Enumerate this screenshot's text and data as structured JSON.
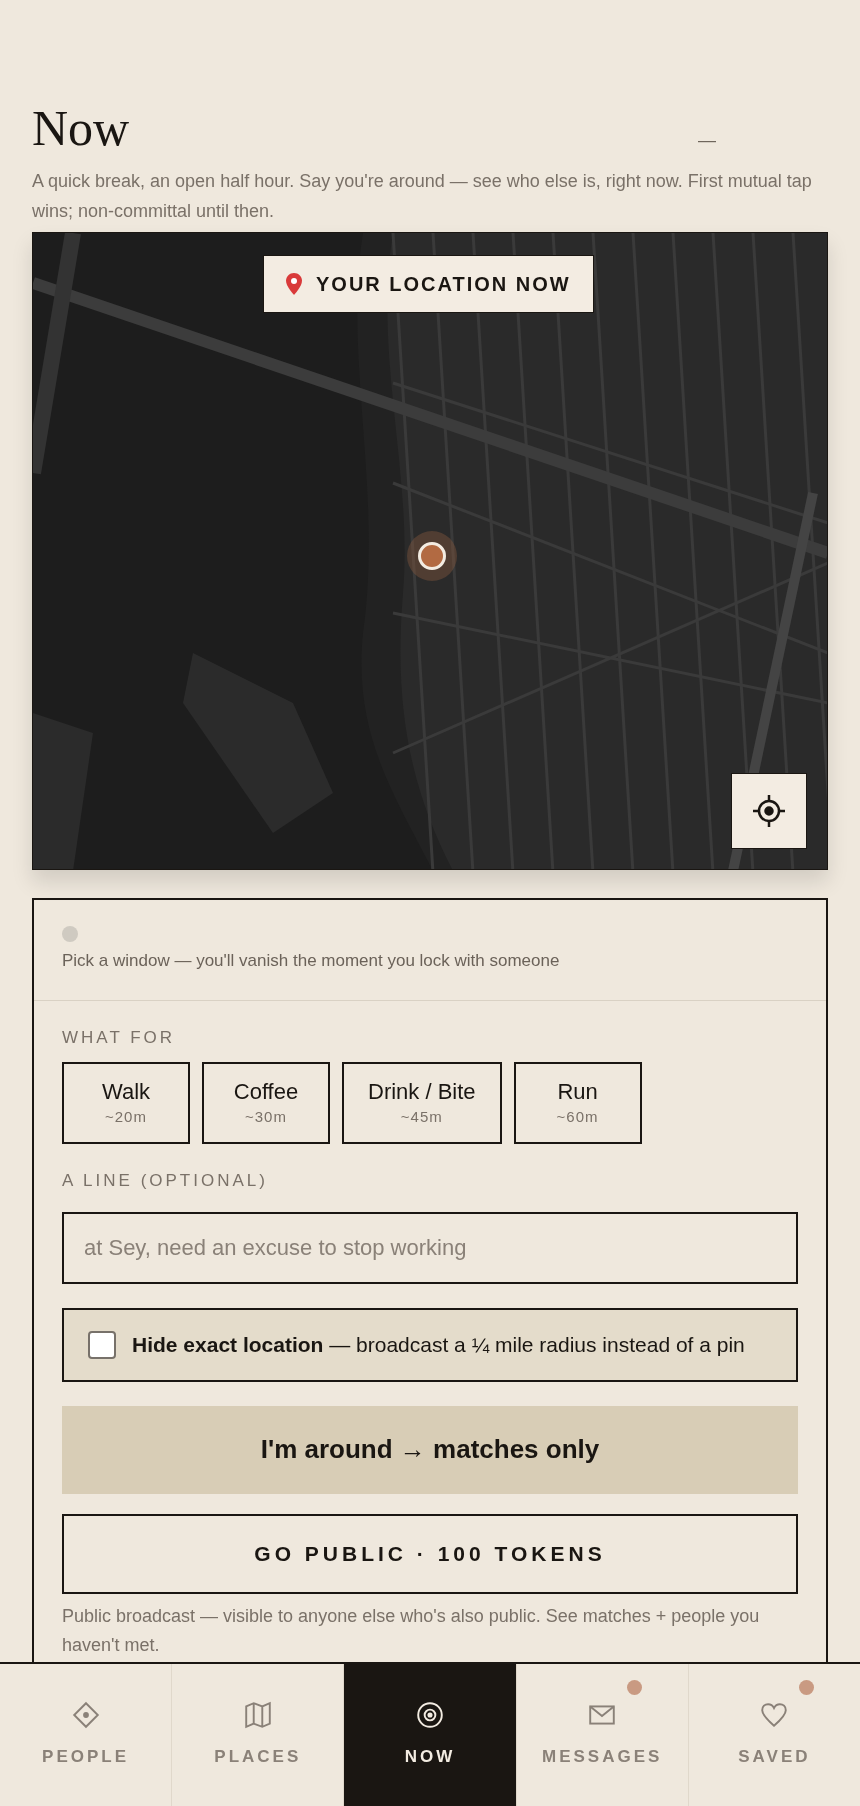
{
  "header": {
    "title": "Now",
    "mark": "—",
    "intro": "A quick break, an open half hour. Say you're around — see who else is, right now. First mutual tap wins; non-committal until then."
  },
  "map": {
    "kind": "picture",
    "badge": "YOUR LOCATION NOW"
  },
  "panel": {
    "status_hint": "Pick a window — you'll vanish the moment you lock with someone",
    "what_for_label": "WHAT FOR",
    "options": [
      {
        "label": "Walk",
        "duration": "~20m",
        "selected": false
      },
      {
        "label": "Coffee",
        "duration": "~30m",
        "selected": false
      },
      {
        "label": "Drink / Bite",
        "duration": "~45m",
        "selected": false
      },
      {
        "label": "Run",
        "duration": "~60m",
        "selected": false
      }
    ],
    "line_label": "A LINE (OPTIONAL)",
    "line_field": {
      "placeholder": "at Sey, need an excuse to stop working"
    },
    "hide_location": {
      "text": "**Hide exact location** — broadcast a ¼ mile radius instead of a pin",
      "checked": false
    },
    "primary_button": "I'm around → matches only",
    "public_button": "GO PUBLIC · 100 TOKENS",
    "note": "Public broadcast — visible to anyone else who's also public. See matches + people you haven't met."
  },
  "nav": [
    {
      "label": "PEOPLE",
      "kind": "diamond",
      "selected": false,
      "badge": false
    },
    {
      "label": "PLACES",
      "kind": "map",
      "selected": false,
      "badge": false
    },
    {
      "label": "NOW",
      "kind": "target",
      "selected": true,
      "badge": false
    },
    {
      "label": "MESSAGES",
      "kind": "mail",
      "selected": false,
      "badge": true
    },
    {
      "label": "SAVED",
      "kind": "heart",
      "selected": false,
      "badge": true
    }
  ]
}
